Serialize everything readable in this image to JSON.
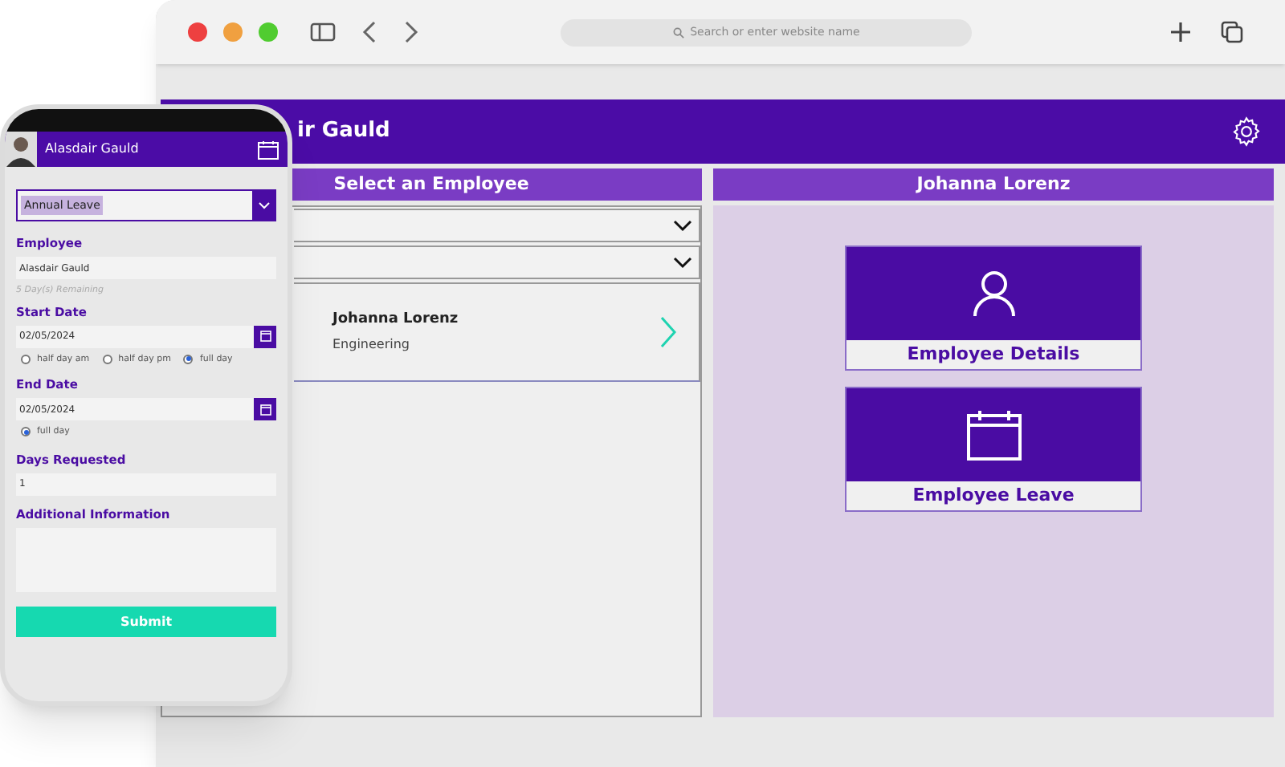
{
  "browser": {
    "address_placeholder": "Search or enter website name"
  },
  "desktop_app": {
    "header_title": "ir Gauld",
    "left_panel": {
      "title": "Select an Employee",
      "employees": [
        {
          "name": "Johanna Lorenz",
          "department": "Engineering"
        }
      ]
    },
    "right_panel": {
      "title": "Johanna Lorenz",
      "tiles": [
        {
          "label": "Employee Details",
          "kind": "person"
        },
        {
          "label": "Employee Leave",
          "kind": "calendar"
        }
      ]
    }
  },
  "mobile_app": {
    "user_name": "Alasdair Gauld",
    "leave_type": "Annual Leave",
    "employee": {
      "label": "Employee",
      "value": "Alasdair Gauld",
      "note": "5 Day(s) Remaining"
    },
    "start_date": {
      "label": "Start Date",
      "value": "02/05/2024",
      "options": [
        {
          "label": "half day am",
          "selected": false
        },
        {
          "label": "half day pm",
          "selected": false
        },
        {
          "label": "full day",
          "selected": true
        }
      ]
    },
    "end_date": {
      "label": "End Date",
      "value": "02/05/2024",
      "options": [
        {
          "label": "full day",
          "selected": true
        }
      ]
    },
    "days_requested": {
      "label": "Days Requested",
      "value": "1"
    },
    "additional_information": {
      "label": "Additional Information"
    },
    "submit": "Submit"
  }
}
